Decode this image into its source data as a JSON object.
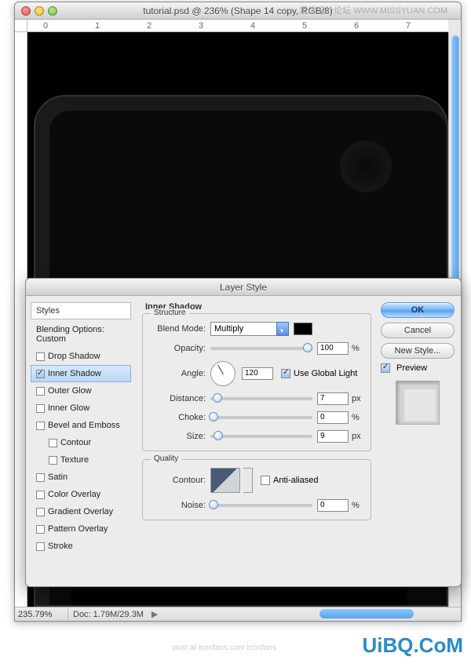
{
  "watermarks": {
    "top": "思缘设计论坛 WWW.MISSYUAN.COM",
    "bottom": "UiBQ.CoM",
    "iconfans": "post at iconfans.com iconfans"
  },
  "window": {
    "title": "tutorial.psd @ 236% (Shape 14 copy, RGB/8)",
    "ruler_marks": [
      "0",
      "1",
      "2",
      "3",
      "4",
      "5",
      "6",
      "7"
    ],
    "zoom": "235.79%",
    "docsize": "Doc: 1.79M/29.3M"
  },
  "dialog": {
    "title": "Layer Style",
    "sidebar": {
      "header": "Styles",
      "items": [
        {
          "label": "Blending Options: Custom",
          "checkbox": false,
          "checked": false
        },
        {
          "label": "Drop Shadow",
          "checkbox": true,
          "checked": false
        },
        {
          "label": "Inner Shadow",
          "checkbox": true,
          "checked": true,
          "active": true
        },
        {
          "label": "Outer Glow",
          "checkbox": true,
          "checked": false
        },
        {
          "label": "Inner Glow",
          "checkbox": true,
          "checked": false
        },
        {
          "label": "Bevel and Emboss",
          "checkbox": true,
          "checked": false
        },
        {
          "label": "Contour",
          "checkbox": true,
          "checked": false,
          "indent": true
        },
        {
          "label": "Texture",
          "checkbox": true,
          "checked": false,
          "indent": true
        },
        {
          "label": "Satin",
          "checkbox": true,
          "checked": false
        },
        {
          "label": "Color Overlay",
          "checkbox": true,
          "checked": false
        },
        {
          "label": "Gradient Overlay",
          "checkbox": true,
          "checked": false
        },
        {
          "label": "Pattern Overlay",
          "checkbox": true,
          "checked": false
        },
        {
          "label": "Stroke",
          "checkbox": true,
          "checked": false
        }
      ]
    },
    "panel": {
      "title": "Inner Shadow",
      "structure": {
        "legend": "Structure",
        "blend_mode_label": "Blend Mode:",
        "blend_mode_value": "Multiply",
        "opacity_label": "Opacity:",
        "opacity_value": "100",
        "opacity_unit": "%",
        "angle_label": "Angle:",
        "angle_value": "120",
        "global_light_label": "Use Global Light",
        "distance_label": "Distance:",
        "distance_value": "7",
        "choke_label": "Choke:",
        "choke_value": "0",
        "size_label": "Size:",
        "size_value": "9",
        "px_unit": "px",
        "pct_unit": "%"
      },
      "quality": {
        "legend": "Quality",
        "contour_label": "Contour:",
        "anti_aliased_label": "Anti-aliased",
        "noise_label": "Noise:",
        "noise_value": "0",
        "noise_unit": "%"
      }
    },
    "buttons": {
      "ok": "OK",
      "cancel": "Cancel",
      "new_style": "New Style...",
      "preview": "Preview"
    }
  }
}
